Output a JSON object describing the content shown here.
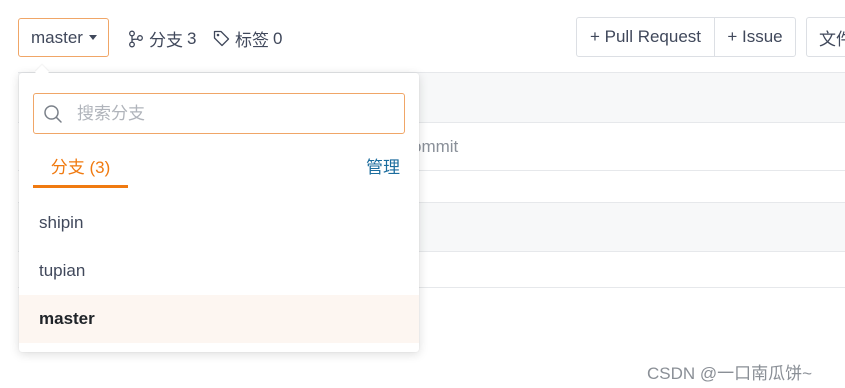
{
  "toolbar": {
    "branch_select_label": "master",
    "branches_label": "分支",
    "branches_count": "3",
    "tags_label": "标签",
    "tags_count": "0",
    "pull_request_label": "+ Pull Request",
    "issue_label": "+ Issue",
    "file_label": "文件"
  },
  "background": {
    "commit_text": "ommit"
  },
  "dropdown": {
    "search": {
      "placeholder": "搜索分支",
      "value": ""
    },
    "tab_label": "分支 (3)",
    "manage_label": "管理",
    "branches": [
      {
        "name": "shipin",
        "current": false
      },
      {
        "name": "tupian",
        "current": false
      },
      {
        "name": "master",
        "current": true
      }
    ]
  },
  "watermark": "CSDN @一口南瓜饼~",
  "colors": {
    "accent": "#f07a10",
    "input_border": "#f0a667",
    "link": "#1c6d9e",
    "selected_row": "#fdf6f1"
  }
}
